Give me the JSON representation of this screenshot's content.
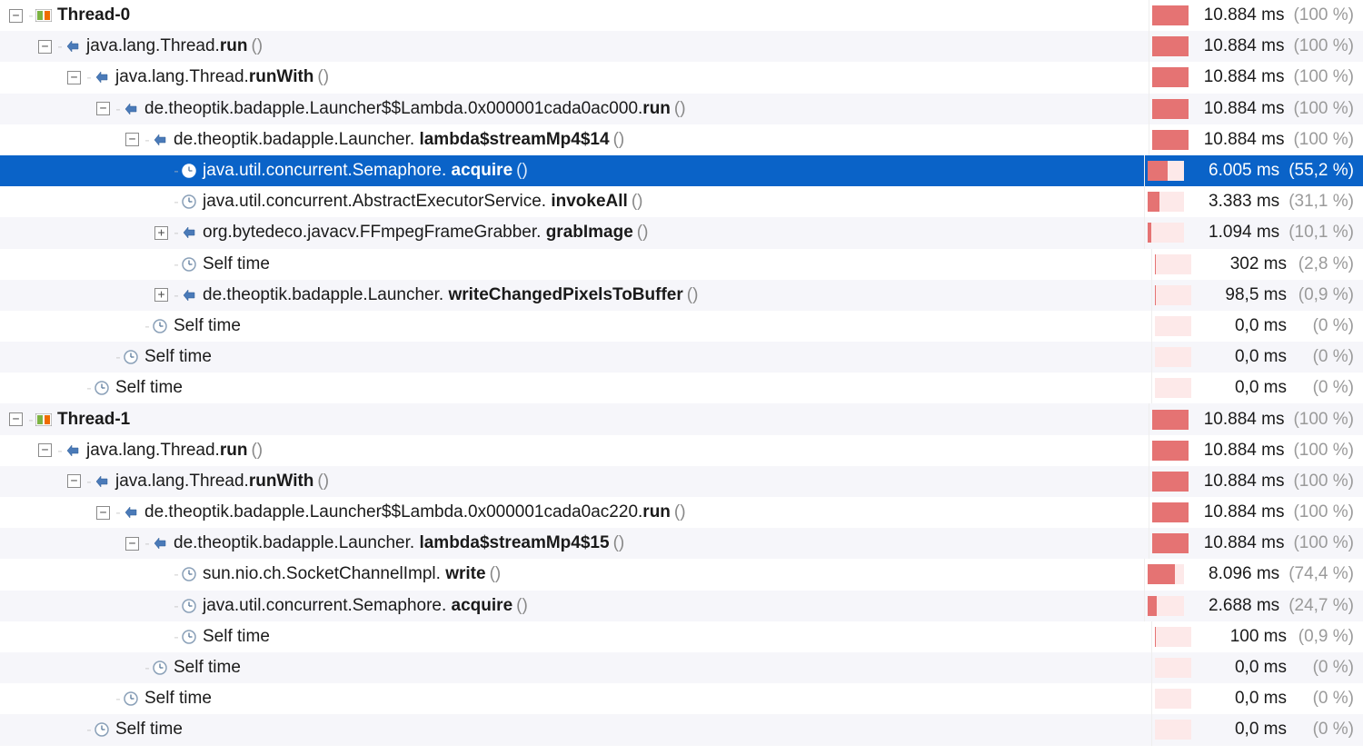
{
  "rows": [
    {
      "indent": 0,
      "toggle": "-",
      "icon": "thread",
      "prefix": "",
      "bold": "Thread-0",
      "args": "",
      "time": "10.884 ms",
      "pct": "(100 %)",
      "bar": 100,
      "alt": false,
      "sel": false
    },
    {
      "indent": 1,
      "toggle": "-",
      "icon": "method",
      "prefix": "java.lang.Thread.",
      "bold": "run",
      "args": "()",
      "time": "10.884 ms",
      "pct": "(100 %)",
      "bar": 100,
      "alt": true,
      "sel": false
    },
    {
      "indent": 2,
      "toggle": "-",
      "icon": "method",
      "prefix": "java.lang.Thread.",
      "bold": "runWith",
      "args": "()",
      "time": "10.884 ms",
      "pct": "(100 %)",
      "bar": 100,
      "alt": false,
      "sel": false
    },
    {
      "indent": 3,
      "toggle": "-",
      "icon": "method",
      "prefix": "de.theoptik.badapple.Launcher$$Lambda.0x000001cada0ac000.",
      "bold": "run",
      "args": "()",
      "time": "10.884 ms",
      "pct": "(100 %)",
      "bar": 100,
      "alt": true,
      "sel": false
    },
    {
      "indent": 4,
      "toggle": "-",
      "icon": "method",
      "prefix": "de.theoptik.badapple.Launcher. ",
      "bold": "lambda$streamMp4$14",
      "args": "()",
      "time": "10.884 ms",
      "pct": "(100 %)",
      "bar": 100,
      "alt": false,
      "sel": false
    },
    {
      "indent": 5,
      "toggle": "",
      "icon": "clock",
      "prefix": "java.util.concurrent.Semaphore. ",
      "bold": "acquire",
      "args": "()",
      "time": "6.005 ms",
      "pct": "(55,2 %)",
      "bar": 55.2,
      "alt": true,
      "sel": true
    },
    {
      "indent": 5,
      "toggle": "",
      "icon": "clock",
      "prefix": "java.util.concurrent.AbstractExecutorService. ",
      "bold": "invokeAll",
      "args": "()",
      "time": "3.383 ms",
      "pct": "(31,1 %)",
      "bar": 31.1,
      "alt": false,
      "sel": false
    },
    {
      "indent": 5,
      "toggle": "+",
      "icon": "method",
      "prefix": "org.bytedeco.javacv.FFmpegFrameGrabber. ",
      "bold": "grabImage",
      "args": "()",
      "time": "1.094 ms",
      "pct": "(10,1 %)",
      "bar": 10.1,
      "alt": true,
      "sel": false
    },
    {
      "indent": 5,
      "toggle": "",
      "icon": "clock",
      "prefix": "",
      "bold": "",
      "plain": "Self time",
      "args": "",
      "time": "302 ms",
      "pct": "(2,8 %)",
      "bar": 2.8,
      "alt": false,
      "sel": false
    },
    {
      "indent": 5,
      "toggle": "+",
      "icon": "method",
      "prefix": "de.theoptik.badapple.Launcher. ",
      "bold": "writeChangedPixelsToBuffer",
      "args": "()",
      "time": "98,5 ms",
      "pct": "(0,9 %)",
      "bar": 0.9,
      "alt": true,
      "sel": false
    },
    {
      "indent": 4,
      "toggle": "",
      "icon": "clock",
      "prefix": "",
      "bold": "",
      "plain": "Self time",
      "args": "",
      "time": "0,0 ms",
      "pct": "(0 %)",
      "bar": 0,
      "alt": false,
      "sel": false
    },
    {
      "indent": 3,
      "toggle": "",
      "icon": "clock",
      "prefix": "",
      "bold": "",
      "plain": "Self time",
      "args": "",
      "time": "0,0 ms",
      "pct": "(0 %)",
      "bar": 0,
      "alt": true,
      "sel": false
    },
    {
      "indent": 2,
      "toggle": "",
      "icon": "clock",
      "prefix": "",
      "bold": "",
      "plain": "Self time",
      "args": "",
      "time": "0,0 ms",
      "pct": "(0 %)",
      "bar": 0,
      "alt": false,
      "sel": false
    },
    {
      "indent": 0,
      "toggle": "-",
      "icon": "thread",
      "prefix": "",
      "bold": "Thread-1",
      "args": "",
      "time": "10.884 ms",
      "pct": "(100 %)",
      "bar": 100,
      "alt": true,
      "sel": false
    },
    {
      "indent": 1,
      "toggle": "-",
      "icon": "method",
      "prefix": "java.lang.Thread.",
      "bold": "run",
      "args": "()",
      "time": "10.884 ms",
      "pct": "(100 %)",
      "bar": 100,
      "alt": false,
      "sel": false
    },
    {
      "indent": 2,
      "toggle": "-",
      "icon": "method",
      "prefix": "java.lang.Thread.",
      "bold": "runWith",
      "args": "()",
      "time": "10.884 ms",
      "pct": "(100 %)",
      "bar": 100,
      "alt": true,
      "sel": false
    },
    {
      "indent": 3,
      "toggle": "-",
      "icon": "method",
      "prefix": "de.theoptik.badapple.Launcher$$Lambda.0x000001cada0ac220.",
      "bold": "run",
      "args": "()",
      "time": "10.884 ms",
      "pct": "(100 %)",
      "bar": 100,
      "alt": false,
      "sel": false
    },
    {
      "indent": 4,
      "toggle": "-",
      "icon": "method",
      "prefix": "de.theoptik.badapple.Launcher. ",
      "bold": "lambda$streamMp4$15",
      "args": "()",
      "time": "10.884 ms",
      "pct": "(100 %)",
      "bar": 100,
      "alt": true,
      "sel": false
    },
    {
      "indent": 5,
      "toggle": "",
      "icon": "clock",
      "prefix": "sun.nio.ch.SocketChannelImpl. ",
      "bold": "write",
      "args": "()",
      "time": "8.096 ms",
      "pct": "(74,4 %)",
      "bar": 74.4,
      "alt": false,
      "sel": false
    },
    {
      "indent": 5,
      "toggle": "",
      "icon": "clock",
      "prefix": "java.util.concurrent.Semaphore. ",
      "bold": "acquire",
      "args": "()",
      "time": "2.688 ms",
      "pct": "(24,7 %)",
      "bar": 24.7,
      "alt": true,
      "sel": false
    },
    {
      "indent": 5,
      "toggle": "",
      "icon": "clock",
      "prefix": "",
      "bold": "",
      "plain": "Self time",
      "args": "",
      "time": "100 ms",
      "pct": "(0,9 %)",
      "bar": 0.9,
      "alt": false,
      "sel": false
    },
    {
      "indent": 4,
      "toggle": "",
      "icon": "clock",
      "prefix": "",
      "bold": "",
      "plain": "Self time",
      "args": "",
      "time": "0,0 ms",
      "pct": "(0 %)",
      "bar": 0,
      "alt": true,
      "sel": false
    },
    {
      "indent": 3,
      "toggle": "",
      "icon": "clock",
      "prefix": "",
      "bold": "",
      "plain": "Self time",
      "args": "",
      "time": "0,0 ms",
      "pct": "(0 %)",
      "bar": 0,
      "alt": false,
      "sel": false
    },
    {
      "indent": 2,
      "toggle": "",
      "icon": "clock",
      "prefix": "",
      "bold": "",
      "plain": "Self time",
      "args": "",
      "time": "0,0 ms",
      "pct": "(0 %)",
      "bar": 0,
      "alt": true,
      "sel": false
    }
  ]
}
